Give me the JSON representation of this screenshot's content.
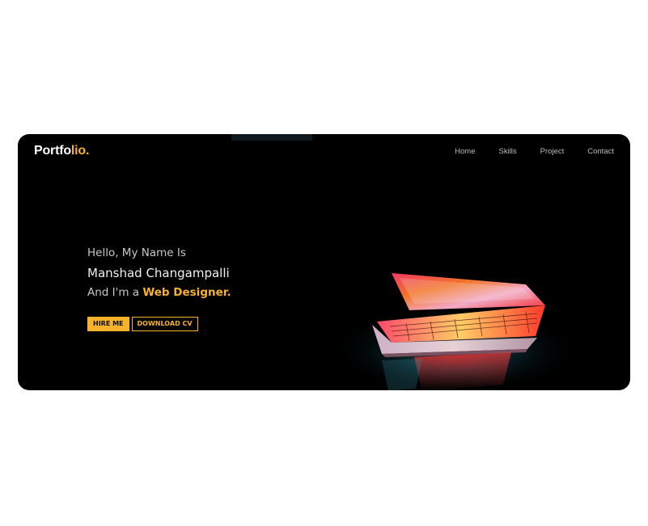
{
  "header": {
    "brand_part1": "Portfo",
    "brand_part2": "lio."
  },
  "nav": {
    "items": [
      "Home",
      "Skills",
      "Project",
      "Contact"
    ]
  },
  "hero": {
    "greeting": "Hello, My Name Is",
    "name": "Manshad Changampalli",
    "role_prefix": "And I'm a ",
    "role": "Web Designer."
  },
  "buttons": {
    "hire": "HIRE ME",
    "download": "DOWNLOAD CV"
  },
  "colors": {
    "accent": "#f5b22a",
    "background": "#000000",
    "nav_text": "#b9b9b9"
  },
  "icons": {
    "hero_image": "laptop-image"
  }
}
